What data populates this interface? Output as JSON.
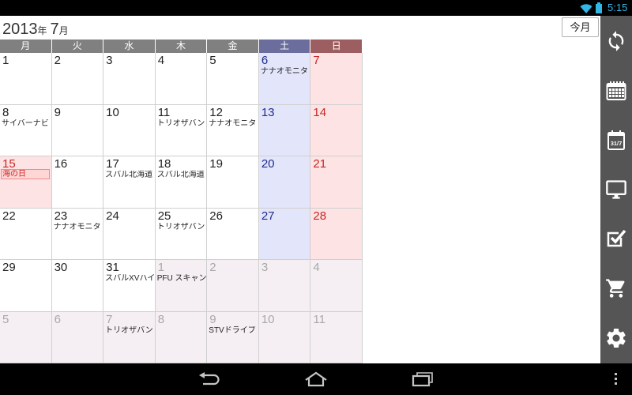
{
  "status_bar": {
    "time": "5:15",
    "icons": [
      "wifi-icon",
      "battery-icon"
    ]
  },
  "header": {
    "year": "2013",
    "year_unit": "年",
    "month": "7",
    "month_unit": "月",
    "this_month_button": "今月"
  },
  "calendar": {
    "weekdays": [
      "月",
      "火",
      "水",
      "木",
      "金",
      "土",
      "日"
    ],
    "weeks": [
      [
        {
          "day": "1"
        },
        {
          "day": "2"
        },
        {
          "day": "3"
        },
        {
          "day": "4"
        },
        {
          "day": "5"
        },
        {
          "day": "6",
          "event": "ナナオモニタ"
        },
        {
          "day": "7"
        }
      ],
      [
        {
          "day": "8",
          "event": "サイバーナビ"
        },
        {
          "day": "9"
        },
        {
          "day": "10"
        },
        {
          "day": "11",
          "event": "トリオザバン"
        },
        {
          "day": "12",
          "event": "ナナオモニタ"
        },
        {
          "day": "13"
        },
        {
          "day": "14"
        }
      ],
      [
        {
          "day": "15",
          "holiday": "海の日"
        },
        {
          "day": "16"
        },
        {
          "day": "17",
          "event": "スバル北海道"
        },
        {
          "day": "18",
          "event": "スバル北海道"
        },
        {
          "day": "19"
        },
        {
          "day": "20"
        },
        {
          "day": "21"
        }
      ],
      [
        {
          "day": "22"
        },
        {
          "day": "23",
          "event": "ナナオモニタ"
        },
        {
          "day": "24"
        },
        {
          "day": "25",
          "event": "トリオザバン"
        },
        {
          "day": "26"
        },
        {
          "day": "27"
        },
        {
          "day": "28"
        }
      ],
      [
        {
          "day": "29"
        },
        {
          "day": "30"
        },
        {
          "day": "31",
          "event": "スバルXVハイ"
        },
        {
          "day": "1",
          "event": "PFU スキャン"
        },
        {
          "day": "2"
        },
        {
          "day": "3"
        },
        {
          "day": "4"
        }
      ],
      [
        {
          "day": "5"
        },
        {
          "day": "6"
        },
        {
          "day": "7",
          "event": "トリオザバン"
        },
        {
          "day": "8"
        },
        {
          "day": "9",
          "event": "STVドライブ"
        },
        {
          "day": "10"
        },
        {
          "day": "11"
        }
      ]
    ]
  },
  "sidebar": {
    "items": [
      {
        "icon": "sync-icon"
      },
      {
        "icon": "calendar-grid-icon"
      },
      {
        "icon": "calendar-date-icon",
        "glyph": "31/7"
      },
      {
        "icon": "monitor-icon"
      },
      {
        "icon": "checkbox-icon"
      },
      {
        "icon": "cart-icon"
      },
      {
        "icon": "gear-icon"
      }
    ]
  },
  "nav_bar": {
    "icons": [
      "back-icon",
      "home-icon",
      "recent-apps-icon",
      "menu-icon"
    ]
  },
  "colors": {
    "status_accent": "#33b5e5",
    "weekday_header": "#808080",
    "saturday_header": "#6b6e9c",
    "sunday_header": "#9c5e60",
    "saturday": "#1f2d8c",
    "sunday": "#c82626",
    "saturday_bg": "#e3e5fa",
    "sunday_bg": "#fde3e3",
    "other_month_bg": "#f5eff4",
    "other_month": "#a8a8a8",
    "sidebar_bg": "#555555"
  }
}
